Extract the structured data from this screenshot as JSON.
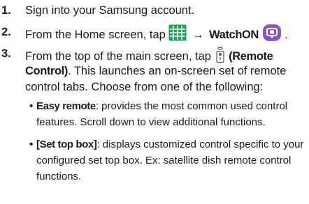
{
  "steps": [
    {
      "number": "1.",
      "text": "Sign into your Samsung account."
    },
    {
      "number": "2.",
      "before": "From the Home screen, tap",
      "apps_icon": "apps-grid-icon",
      "arrow": "→",
      "app_name": "WatchON",
      "app_icon": "watchon-app-icon",
      "after": "."
    },
    {
      "number": "3.",
      "line1_before": "From the top of the main screen, tap",
      "remote_icon": "remote-control-icon",
      "line1_bold": "(Remote",
      "line2_bold": "Control)",
      "line2_rest": ". This launches an on-screen set of remote",
      "line3": "control tabs. Choose from one of the following:"
    }
  ],
  "bullets": [
    {
      "label": "Easy remote",
      "line1_rest": ": provides the most common used control",
      "line2": "features. Scroll down to view additional functions."
    },
    {
      "label": "[Set top box]",
      "line1_rest": ": displays customized control specific to your",
      "line2": "configured set top box. Ex: satellite dish remote control",
      "line3": "functions."
    }
  ],
  "colors": {
    "apps_icon": "#1aa05a",
    "watchon_icon": "#8a55c6",
    "text": "#1a1a1a"
  }
}
